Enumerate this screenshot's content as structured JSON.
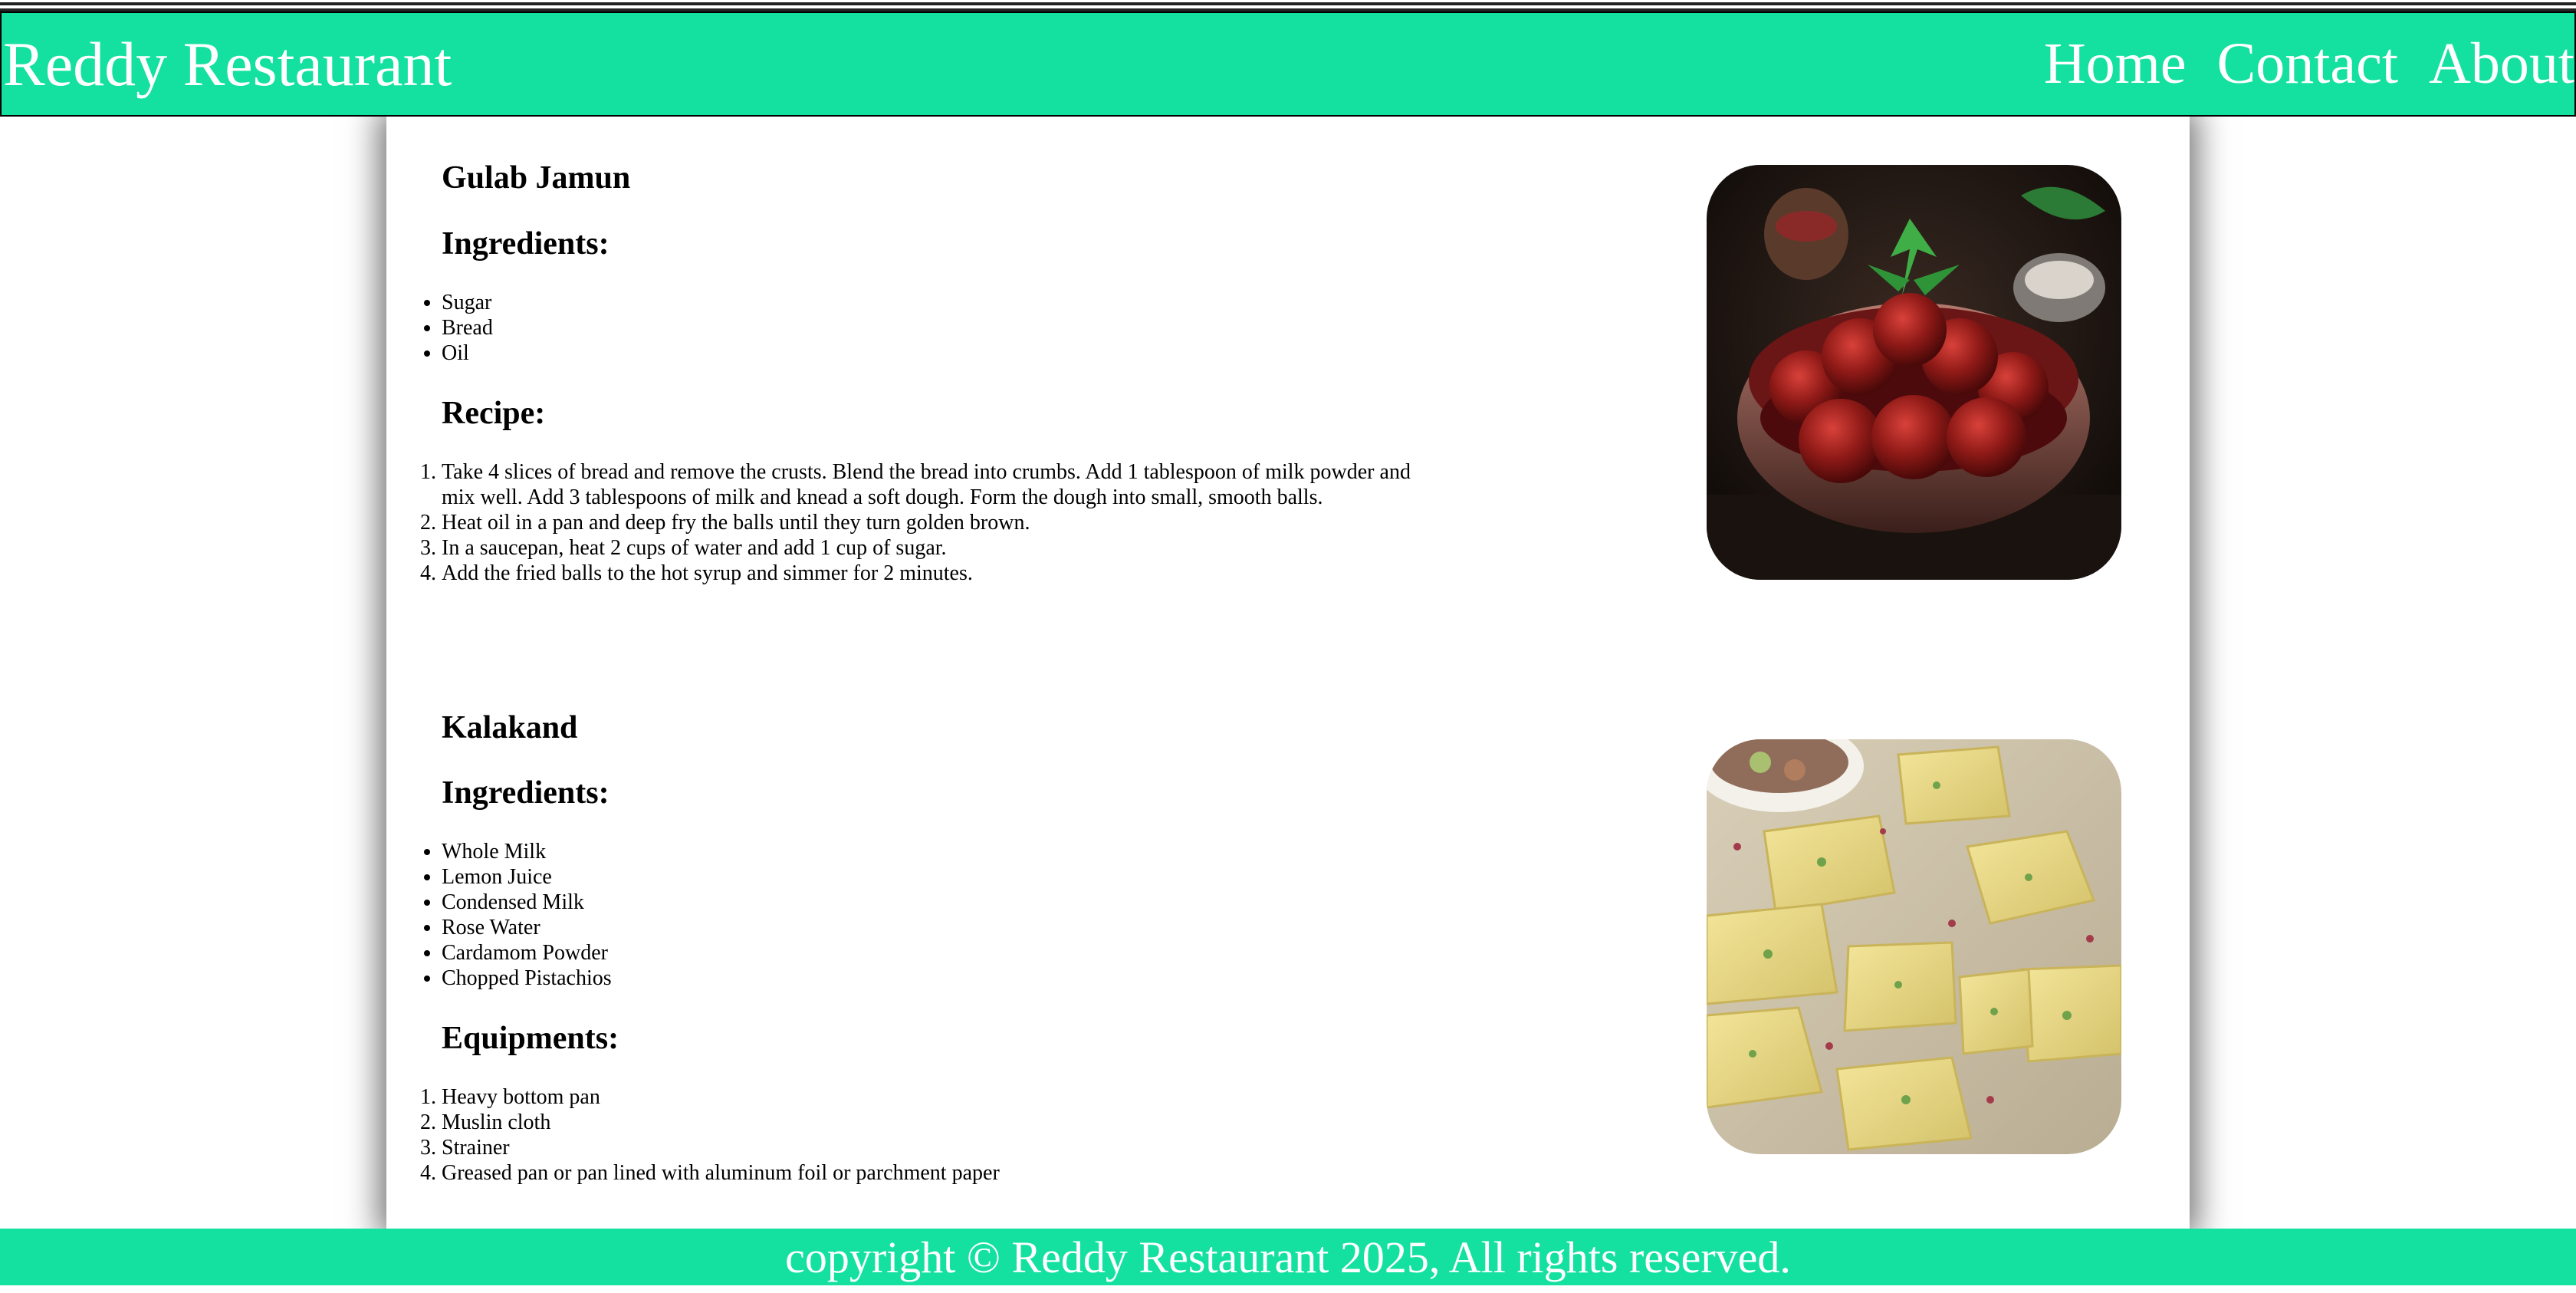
{
  "header": {
    "brand": "Reddy Restaurant",
    "nav": [
      "Home",
      "Contact",
      "About"
    ]
  },
  "recipes": [
    {
      "title": "Gulab Jamun",
      "ingredients_heading": "Ingredients:",
      "ingredients": [
        "Sugar",
        "Bread",
        "Oil"
      ],
      "steps_heading": "Recipe:",
      "steps": [
        "Take 4 slices of bread and remove the crusts. Blend the bread into crumbs. Add 1 tablespoon of milk powder and mix well. Add 3 tablespoons of milk and knead a soft dough. Form the dough into small, smooth balls.",
        "Heat oil in a pan and deep fry the balls until they turn golden brown.",
        "In a saucepan, heat 2 cups of water and add 1 cup of sugar.",
        "Add the fried balls to the hot syrup and simmer for 2 minutes."
      ],
      "image": "gulab-jamun-bowl-photo"
    },
    {
      "title": "Kalakand",
      "ingredients_heading": "Ingredients:",
      "ingredients": [
        "Whole Milk",
        "Lemon Juice",
        "Condensed Milk",
        "Rose Water",
        "Cardamom Powder",
        "Chopped Pistachios"
      ],
      "steps_heading": "Equipments:",
      "steps": [
        "Heavy bottom pan",
        "Muslin cloth",
        "Strainer",
        "Greased pan or pan lined with aluminum foil or parchment paper"
      ],
      "image": "kalakand-squares-photo"
    }
  ],
  "footer": {
    "text": "copyright © Reddy Restaurant 2025, All rights reserved."
  },
  "colors": {
    "accent": "#14e19f",
    "text": "#000000",
    "header_text": "#ffffff"
  }
}
